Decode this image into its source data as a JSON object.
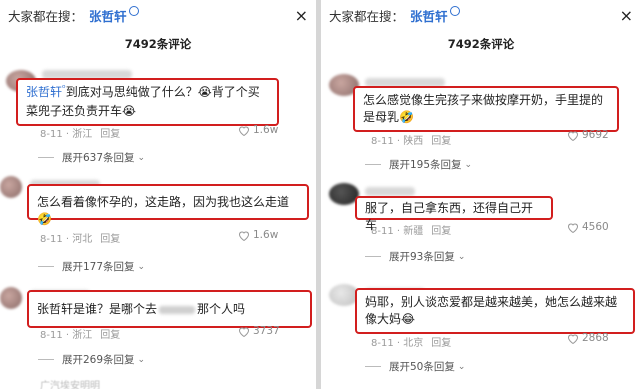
{
  "left": {
    "search_label": "大家都在搜：",
    "search_term": "张哲轩",
    "close": "×",
    "comment_count": "7492条评论",
    "comments": [
      {
        "mention": "张哲轩",
        "text": "到底对马思纯做了什么？😭背了个买菜兜子还负责开车😭",
        "meta": "8-11 · 浙江",
        "reply": "回复",
        "likes": "1.6w",
        "expand": "展开637条回复"
      },
      {
        "text": "怎么看着像怀孕的，这走路，因为我也这么走道🤣",
        "meta": "8-11 · 河北",
        "reply": "回复",
        "likes": "1.6w",
        "expand": "展开177条回复"
      },
      {
        "text_before": "张哲轩是谁？是哪个去",
        "text_after": "那个人吗",
        "meta": "8-11 · 浙江",
        "reply": "回复",
        "likes": "3737",
        "expand": "展开269条回复"
      }
    ],
    "bottom_peek": "广汽埃安明明"
  },
  "right": {
    "search_label": "大家都在搜：",
    "search_term": "张哲轩",
    "close": "×",
    "comment_count": "7492条评论",
    "comments": [
      {
        "text": "怎么感觉像生完孩子来做按摩开奶，手里提的是母乳🤣",
        "meta": "8-11 · 陕西",
        "reply": "回复",
        "likes": "9692",
        "expand": "展开195条回复"
      },
      {
        "text": "服了，自己拿东西，还得自己开车",
        "meta": "8-11 · 新疆",
        "reply": "回复",
        "likes": "4560",
        "expand": "展开93条回复"
      },
      {
        "text": "妈耶，别人谈恋爱都是越来越美，她怎么越来越像大妈😂",
        "meta": "8-11 · 北京",
        "reply": "回复",
        "likes": "2868",
        "expand": "展开50条回复"
      }
    ]
  },
  "colors": {
    "highlight_border": "#d21e1e",
    "link_blue": "#2f6fd0",
    "meta_gray": "#9a9a9a"
  }
}
